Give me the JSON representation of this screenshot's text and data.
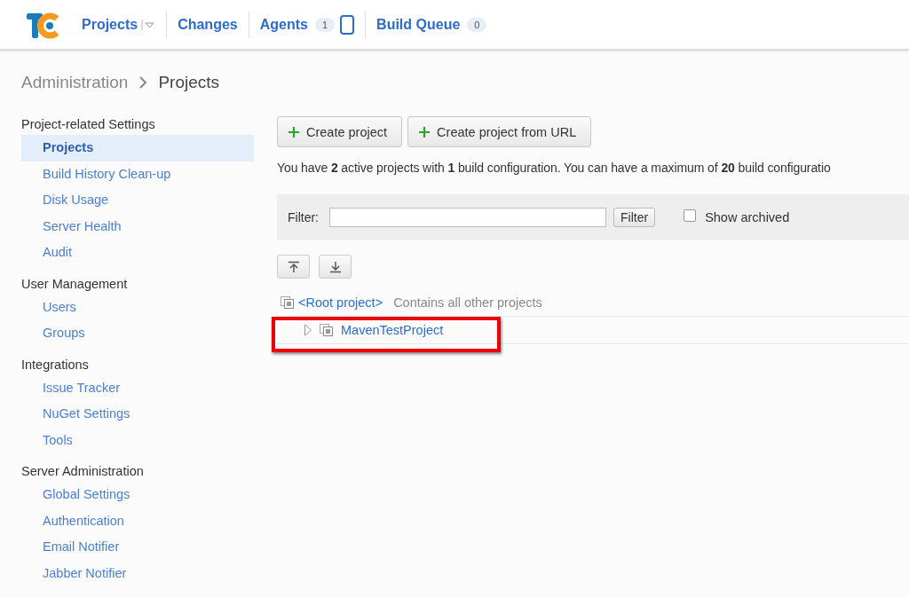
{
  "header": {
    "nav": [
      {
        "label": "Projects",
        "kind": "dropdown"
      },
      {
        "label": "Changes",
        "kind": "plain"
      },
      {
        "label": "Agents",
        "kind": "agents",
        "count": "1"
      },
      {
        "label": "Build Queue",
        "kind": "counter",
        "count": "0"
      }
    ]
  },
  "breadcrumb": [
    "Administration",
    "Projects"
  ],
  "sidebar": {
    "groups": [
      {
        "title": "Project-related Settings",
        "items": [
          {
            "label": "Projects",
            "selected": true
          },
          {
            "label": "Build History Clean-up",
            "selected": false
          },
          {
            "label": "Disk Usage",
            "selected": false
          },
          {
            "label": "Server Health",
            "selected": false
          },
          {
            "label": "Audit",
            "selected": false
          }
        ]
      },
      {
        "title": "User Management",
        "items": [
          {
            "label": "Users",
            "selected": false
          },
          {
            "label": "Groups",
            "selected": false
          }
        ]
      },
      {
        "title": "Integrations",
        "items": [
          {
            "label": "Issue Tracker",
            "selected": false
          },
          {
            "label": "NuGet Settings",
            "selected": false
          },
          {
            "label": "Tools",
            "selected": false
          }
        ]
      },
      {
        "title": "Server Administration",
        "items": [
          {
            "label": "Global Settings",
            "selected": false
          },
          {
            "label": "Authentication",
            "selected": false
          },
          {
            "label": "Email Notifier",
            "selected": false
          },
          {
            "label": "Jabber Notifier",
            "selected": false
          }
        ]
      }
    ]
  },
  "actions": [
    "Create project",
    "Create project from URL"
  ],
  "summary": "You have **2** active projects with **1** build configuration. You can have a maximum of **20** build configuratio",
  "filter": {
    "label": "Filter:",
    "button": "Filter",
    "show_archived": {
      "label": "Show archived",
      "checked": false
    }
  },
  "tree": {
    "root": {
      "name": "<Root project>",
      "description": "Contains all other projects"
    },
    "children": [
      {
        "name": "MavenTestProject",
        "expanded": false,
        "highlighted": true
      }
    ]
  }
}
